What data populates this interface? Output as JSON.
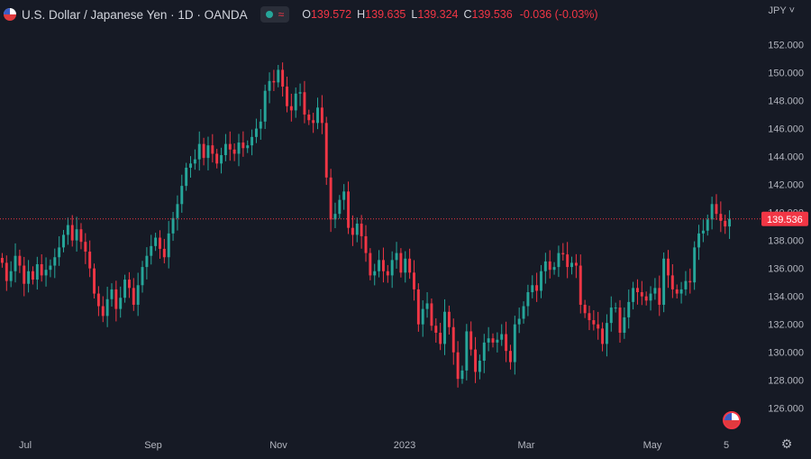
{
  "header": {
    "symbol_title": "U.S. Dollar / Japanese Yen · 1D · OANDA",
    "ohlc": {
      "o_label": "O",
      "o_value": "139.572",
      "h_label": "H",
      "h_value": "139.635",
      "l_label": "L",
      "l_value": "139.324",
      "c_label": "C",
      "c_value": "139.536",
      "change": "-0.036 (-0.03%)"
    },
    "currency": "JPY ˅"
  },
  "colors": {
    "background": "#161a25",
    "up": "#26a69a",
    "down": "#f23645",
    "text": "#b2b5be"
  },
  "chart_data": {
    "type": "candlestick",
    "title": "U.S. Dollar / Japanese Yen · 1D · OANDA",
    "ylim": [
      124.5,
      153.0
    ],
    "y_ticks": [
      126,
      128,
      130,
      132,
      134,
      136,
      138,
      140,
      142,
      144,
      146,
      148,
      150,
      152
    ],
    "x_ticks": [
      "Jul",
      "Sep",
      "Nov",
      "2023",
      "Mar",
      "May",
      "5"
    ],
    "last_price": "139.536",
    "last_value": 139.536,
    "grid": false,
    "closes": [
      136.4,
      135.1,
      135.8,
      136.9,
      136.2,
      134.9,
      135.8,
      135.2,
      136.3,
      135.5,
      135.9,
      136.2,
      136.8,
      137.5,
      138.4,
      139.1,
      138.0,
      138.8,
      137.9,
      137.2,
      136.0,
      134.2,
      133.3,
      132.6,
      133.8,
      134.5,
      133.1,
      133.9,
      135.2,
      134.6,
      133.4,
      134.8,
      136.1,
      136.9,
      137.6,
      138.2,
      137.4,
      136.8,
      138.5,
      139.6,
      140.6,
      141.9,
      143.2,
      143.5,
      143.8,
      144.9,
      143.9,
      144.8,
      144.2,
      143.5,
      144.1,
      144.9,
      144.5,
      144.2,
      145.0,
      144.6,
      144.8,
      145.4,
      146.0,
      146.5,
      148.7,
      149.4,
      149.3,
      150.2,
      149.0,
      147.6,
      147.3,
      148.5,
      148.6,
      147.0,
      146.6,
      146.4,
      147.5,
      146.4,
      142.5,
      139.5,
      139.9,
      140.9,
      141.5,
      138.9,
      138.4,
      139.2,
      138.3,
      137.1,
      135.5,
      135.8,
      136.6,
      135.8,
      135.5,
      136.6,
      137.1,
      135.7,
      136.7,
      135.7,
      134.5,
      132.0,
      133.1,
      133.5,
      131.9,
      131.4,
      130.6,
      132.9,
      131.8,
      130.0,
      128.1,
      128.7,
      131.5,
      130.2,
      128.6,
      129.4,
      130.7,
      131.0,
      130.7,
      130.9,
      131.3,
      130.1,
      129.3,
      132.0,
      132.4,
      133.3,
      134.3,
      134.8,
      134.4,
      135.8,
      136.5,
      135.9,
      136.1,
      137.1,
      137.0,
      136.1,
      136.4,
      136.2,
      133.4,
      132.8,
      132.3,
      132.0,
      131.7,
      130.6,
      132.1,
      133.2,
      133.2,
      131.4,
      132.5,
      133.6,
      134.6,
      134.3,
      134.0,
      133.7,
      134.2,
      134.6,
      133.4,
      136.7,
      135.5,
      134.5,
      134.2,
      134.5,
      135.1,
      135.0,
      137.5,
      138.5,
      138.7,
      139.5,
      140.6,
      139.9,
      139.4,
      139.0,
      139.536
    ],
    "day_count": 169
  }
}
